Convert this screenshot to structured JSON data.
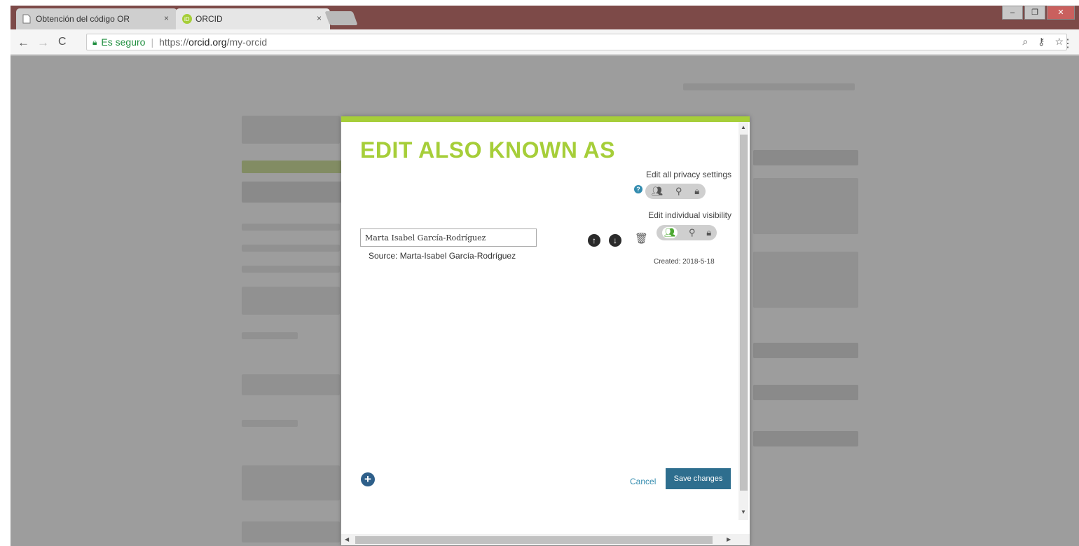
{
  "browser": {
    "tabs": [
      {
        "title": "Obtención del código OR",
        "close": "×"
      },
      {
        "title": "ORCID",
        "close": "×"
      }
    ],
    "address": {
      "secure_label": "Es seguro",
      "url_scheme": "https://",
      "url_host": "orcid.org",
      "url_path": "/my-orcid"
    },
    "window_controls": {
      "minimize": "–",
      "maximize": "❐",
      "close": "✕"
    }
  },
  "modal": {
    "title": "EDIT ALSO KNOWN AS",
    "edit_all_privacy": "Edit all privacy settings",
    "edit_individual_visibility": "Edit individual visibility",
    "help_icon": "?",
    "entry": {
      "name_value": "Marta Isabel García-Rodríguez",
      "source": "Source: Marta-Isabel García-Rodríguez",
      "created": "Created: 2018-5-18"
    },
    "cancel_label": "Cancel",
    "save_label": "Save changes",
    "add_label": "+"
  },
  "colors": {
    "accent_green": "#a6ce39",
    "save_blue": "#2e6e8e",
    "link_blue": "#338caf"
  },
  "icons": {
    "move_up": "arrow-up-icon",
    "move_down": "arrow-down-icon",
    "delete": "trash-icon",
    "visibility_public": "everyone-icon",
    "visibility_limited": "trusted-parties-icon",
    "visibility_private": "lock-icon"
  }
}
